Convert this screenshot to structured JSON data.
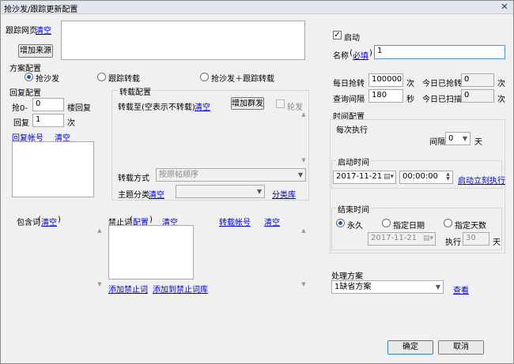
{
  "window": {
    "title": "抢沙发/跟踪更新配置",
    "close": "✕"
  },
  "track": {
    "label": "跟踪网页",
    "clear": "清空",
    "add_source": "增加来源"
  },
  "scheme": {
    "title": "方案配置",
    "options": [
      "抢沙发",
      "跟踪转载",
      "抢沙发＋跟踪转载"
    ],
    "selected": 0
  },
  "reply": {
    "title": "回复配置",
    "grab_prefix": "抢0-",
    "grab_value": "0",
    "grab_suffix": "楼回复",
    "reply_label": "回复",
    "reply_value": "1",
    "reply_suffix": "次",
    "account_link": "回复帐号",
    "clear_link": "清空"
  },
  "repost": {
    "title": "转载配置",
    "to_label": "转载至(空表示不转载)",
    "clear_link": "清空",
    "add_post": "增加群发",
    "mass_label": "轮发",
    "mode_label": "转载方式",
    "mode_value": "按原帖顺序",
    "topic_label": "主题分类",
    "topic_clear": "清空",
    "category_link": "分类库"
  },
  "keywords": {
    "include_label": "包含词",
    "include_clear": "清空",
    "ban_label": "禁止词",
    "ban_config": "配置",
    "ban_clear": "清空",
    "repost_account": "转载帐号",
    "repost_clear": "清空",
    "add_ban": "添加禁止词",
    "add_to_ban_lib": "添加到禁止词库"
  },
  "settings": {
    "enable_label": "启动",
    "enable_checked": true,
    "name_label": "名称",
    "name_link": "必填",
    "name_value": "1",
    "daily_grab_label": "每日抢转",
    "daily_grab_value": "100000",
    "daily_grab_unit": "次",
    "today_grabbed_label": "今日已抢转",
    "today_grabbed_value": "0",
    "today_grabbed_unit": "次",
    "query_interval_label": "查询间隔",
    "query_interval_value": "180",
    "query_interval_unit": "秒",
    "today_scanned_label": "今日已扫描",
    "today_scanned_value": "0",
    "today_scanned_unit": "次"
  },
  "time": {
    "title": "时间配置",
    "every_exec": "每次执行",
    "interval_label": "间隔",
    "interval_value": "0",
    "interval_unit": "天",
    "start_title": "启动时间",
    "start_date": "2017-11-21",
    "start_time": "00:00:00",
    "start_now_link": "启动立刻执行",
    "end_title": "结束时间",
    "end_options": [
      "永久",
      "指定日期",
      "指定天数"
    ],
    "end_selected": 0,
    "end_date": "2017-11-21",
    "exec_label": "执行",
    "exec_value": "30",
    "exec_unit": "天"
  },
  "process": {
    "title": "处理方案",
    "value": "1缺省方案",
    "view_link": "查看"
  },
  "footer": {
    "ok": "确定",
    "cancel": "取消"
  }
}
